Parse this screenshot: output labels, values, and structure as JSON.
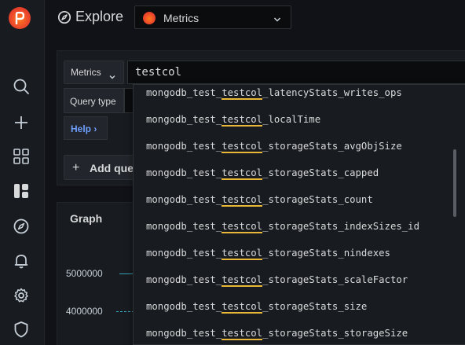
{
  "topbar": {
    "title": "Explore",
    "datasource": "Metrics"
  },
  "sidebar": {
    "items": [
      {
        "icon": "search-icon"
      },
      {
        "icon": "plus-icon"
      },
      {
        "icon": "dashboards-icon"
      },
      {
        "icon": "explore-active-icon"
      },
      {
        "icon": "compass-icon"
      },
      {
        "icon": "bell-icon"
      },
      {
        "icon": "gear-icon"
      },
      {
        "icon": "shield-icon"
      }
    ]
  },
  "query": {
    "metrics_label": "Metrics",
    "input_value": "testcol",
    "query_type_label": "Query type",
    "help_label": "Help",
    "add_query_label": "Add query"
  },
  "graph": {
    "title": "Graph",
    "y_ticks": [
      "5000000",
      "4000000"
    ]
  },
  "suggestions": [
    {
      "pre": "mongodb_test_",
      "match": "testcol",
      "post": "_latencyStats_writes_ops"
    },
    {
      "pre": "mongodb_test_",
      "match": "testcol",
      "post": "_localTime"
    },
    {
      "pre": "mongodb_test_",
      "match": "testcol",
      "post": "_storageStats_avgObjSize"
    },
    {
      "pre": "mongodb_test_",
      "match": "testcol",
      "post": "_storageStats_capped"
    },
    {
      "pre": "mongodb_test_",
      "match": "testcol",
      "post": "_storageStats_count"
    },
    {
      "pre": "mongodb_test_",
      "match": "testcol",
      "post": "_storageStats_indexSizes_id"
    },
    {
      "pre": "mongodb_test_",
      "match": "testcol",
      "post": "_storageStats_nindexes"
    },
    {
      "pre": "mongodb_test_",
      "match": "testcol",
      "post": "_storageStats_scaleFactor"
    },
    {
      "pre": "mongodb_test_",
      "match": "testcol",
      "post": "_storageStats_size"
    },
    {
      "pre": "mongodb_test_",
      "match": "testcol",
      "post": "_storageStats_storageSize"
    }
  ],
  "colors": {
    "background": "#111217",
    "panel": "#181b1f",
    "highlight_underline": "#eab839",
    "help_link": "#6e9fff",
    "brand": "#f0502a"
  }
}
